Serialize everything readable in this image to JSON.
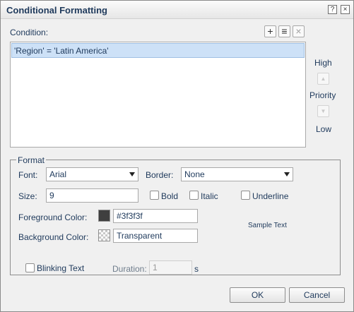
{
  "window": {
    "title": "Conditional Formatting",
    "help_glyph": "?",
    "close_glyph": "×"
  },
  "condition": {
    "label": "Condition:",
    "add_glyph": "+",
    "edit_glyph": "≡",
    "delete_glyph": "×",
    "items": [
      "'Region' = 'Latin America'"
    ],
    "priority": {
      "high": "High",
      "label": "Priority",
      "low": "Low",
      "up_glyph": "▲",
      "down_glyph": "▼"
    }
  },
  "format": {
    "legend": "Format",
    "font_label": "Font:",
    "font_value": "Arial",
    "border_label": "Border:",
    "border_value": "None",
    "size_label": "Size:",
    "size_value": "9",
    "bold_label": "Bold",
    "italic_label": "Italic",
    "underline_label": "Underline",
    "fg_label": "Foreground Color:",
    "fg_value": "#3f3f3f",
    "bg_label": "Background Color:",
    "bg_value": "Transparent",
    "sample_text": "Sample Text",
    "blinking_label": "Blinking Text",
    "duration_label": "Duration:",
    "duration_value": "1",
    "duration_unit": "s"
  },
  "buttons": {
    "ok": "OK",
    "cancel": "Cancel"
  },
  "colors": {
    "selection": "#cde1f7",
    "label_text": "#1e395b",
    "foreground_swatch": "#3f3f3f"
  }
}
